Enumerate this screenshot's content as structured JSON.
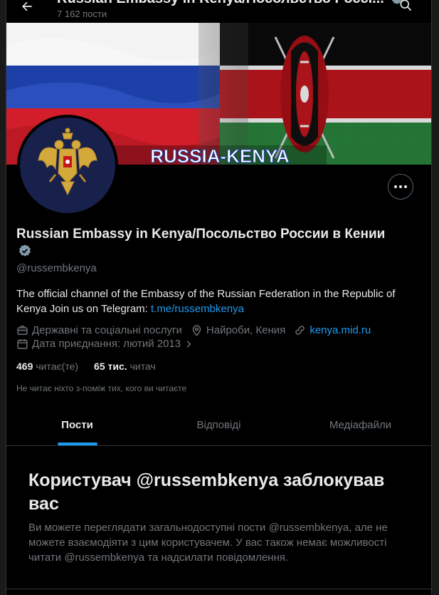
{
  "header": {
    "title": "Russian Embassy in Kenya/Посольство Россі...",
    "post_count": "7 162 пости"
  },
  "banner": {
    "text": "RUSSIA-KENYA"
  },
  "profile": {
    "display_name": "Russian Embassy in Kenya/Посольство России в Кении",
    "handle": "@russembkenya",
    "bio_text": "The official channel of the Embassy of the Russian Federation in the Republic of Kenya Join us on Telegram: ",
    "bio_link": "t.me/russembkenya",
    "category": "Державні та соціальні послуги",
    "location": "Найроби, Кения",
    "website": "kenya.mid.ru",
    "joined": "Дата приєднання: лютий 2013",
    "following_count": "469",
    "following_label": "читає(те)",
    "followers_count": "65 тис.",
    "followers_label": "читач",
    "not_followed_note": "Не читає ніхто з-поміж тих, кого ви читаєте"
  },
  "tabs": [
    {
      "label": "Пости",
      "active": true
    },
    {
      "label": "Відповіді",
      "active": false
    },
    {
      "label": "Медіафайли",
      "active": false
    }
  ],
  "blocked": {
    "title": "Користувач @russembkenya заблокував вас",
    "text": "Ви можете переглядати загальнодоступні пости @russembkenya, але не можете взаємодіяти з цим користувачем. У вас також немає можливості читати @russembkenya та надсилати повідомлення."
  },
  "colors": {
    "background": "#000000",
    "text_primary": "#e7e9ea",
    "text_secondary": "#71767b",
    "accent": "#1d9bf0",
    "verified_badge": "#829aab"
  },
  "icons": [
    "back-arrow-icon",
    "search-icon",
    "more-icon",
    "verified-badge-icon",
    "briefcase-icon",
    "location-pin-icon",
    "link-icon",
    "calendar-icon",
    "chevron-right-icon"
  ]
}
